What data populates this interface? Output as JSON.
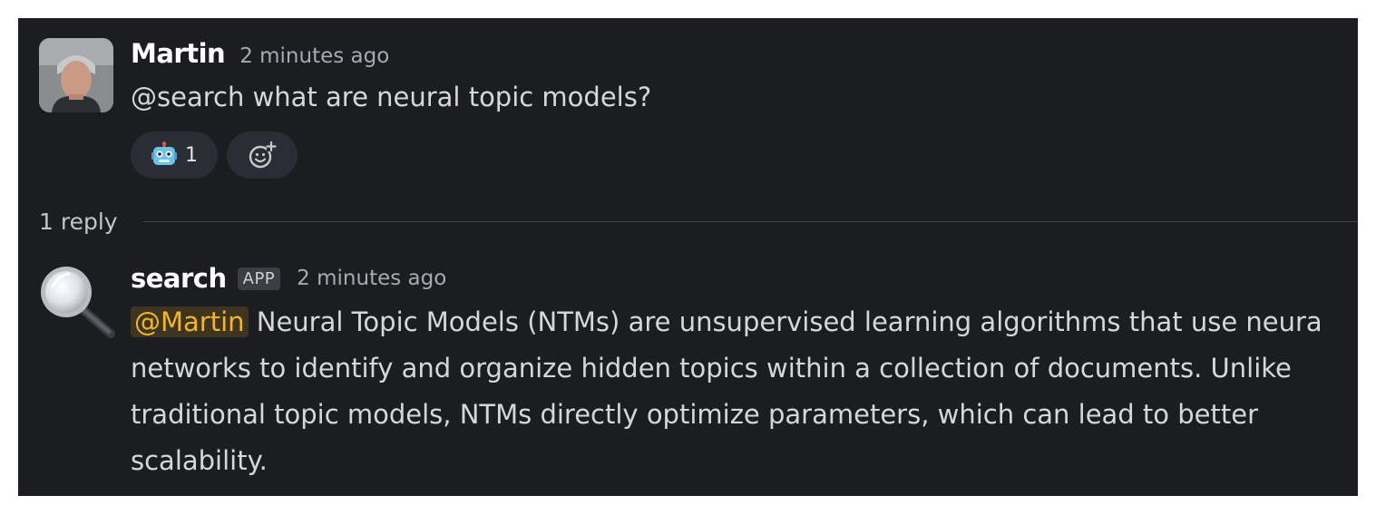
{
  "message": {
    "author": "Martin",
    "time": "2 minutes ago",
    "text": "@search what are neural topic models?",
    "reactions": [
      {
        "emoji": "robot-face",
        "count": "1"
      }
    ]
  },
  "thread": {
    "reply_count": "1 reply"
  },
  "reply": {
    "author": "search",
    "badge": "APP",
    "time": "2 minutes ago",
    "mention": "@Martin",
    "lines": [
      " Neural Topic Models (NTMs) are unsupervised learning algorithms that use neura",
      "networks to identify and organize hidden topics within a collection of documents. Unlike",
      "traditional topic models, NTMs directly optimize parameters, which can lead to better",
      "scalability."
    ]
  },
  "icons": {
    "user_avatar": "user-photo",
    "bot_avatar": "magnifying-glass",
    "reaction": "robot-face",
    "add_reaction": "smiley-plus"
  },
  "colors": {
    "background": "#1b1d21",
    "mention_text": "#f0b52e",
    "mention_bg": "#3e3420",
    "pill_bg": "#2a2d33"
  }
}
